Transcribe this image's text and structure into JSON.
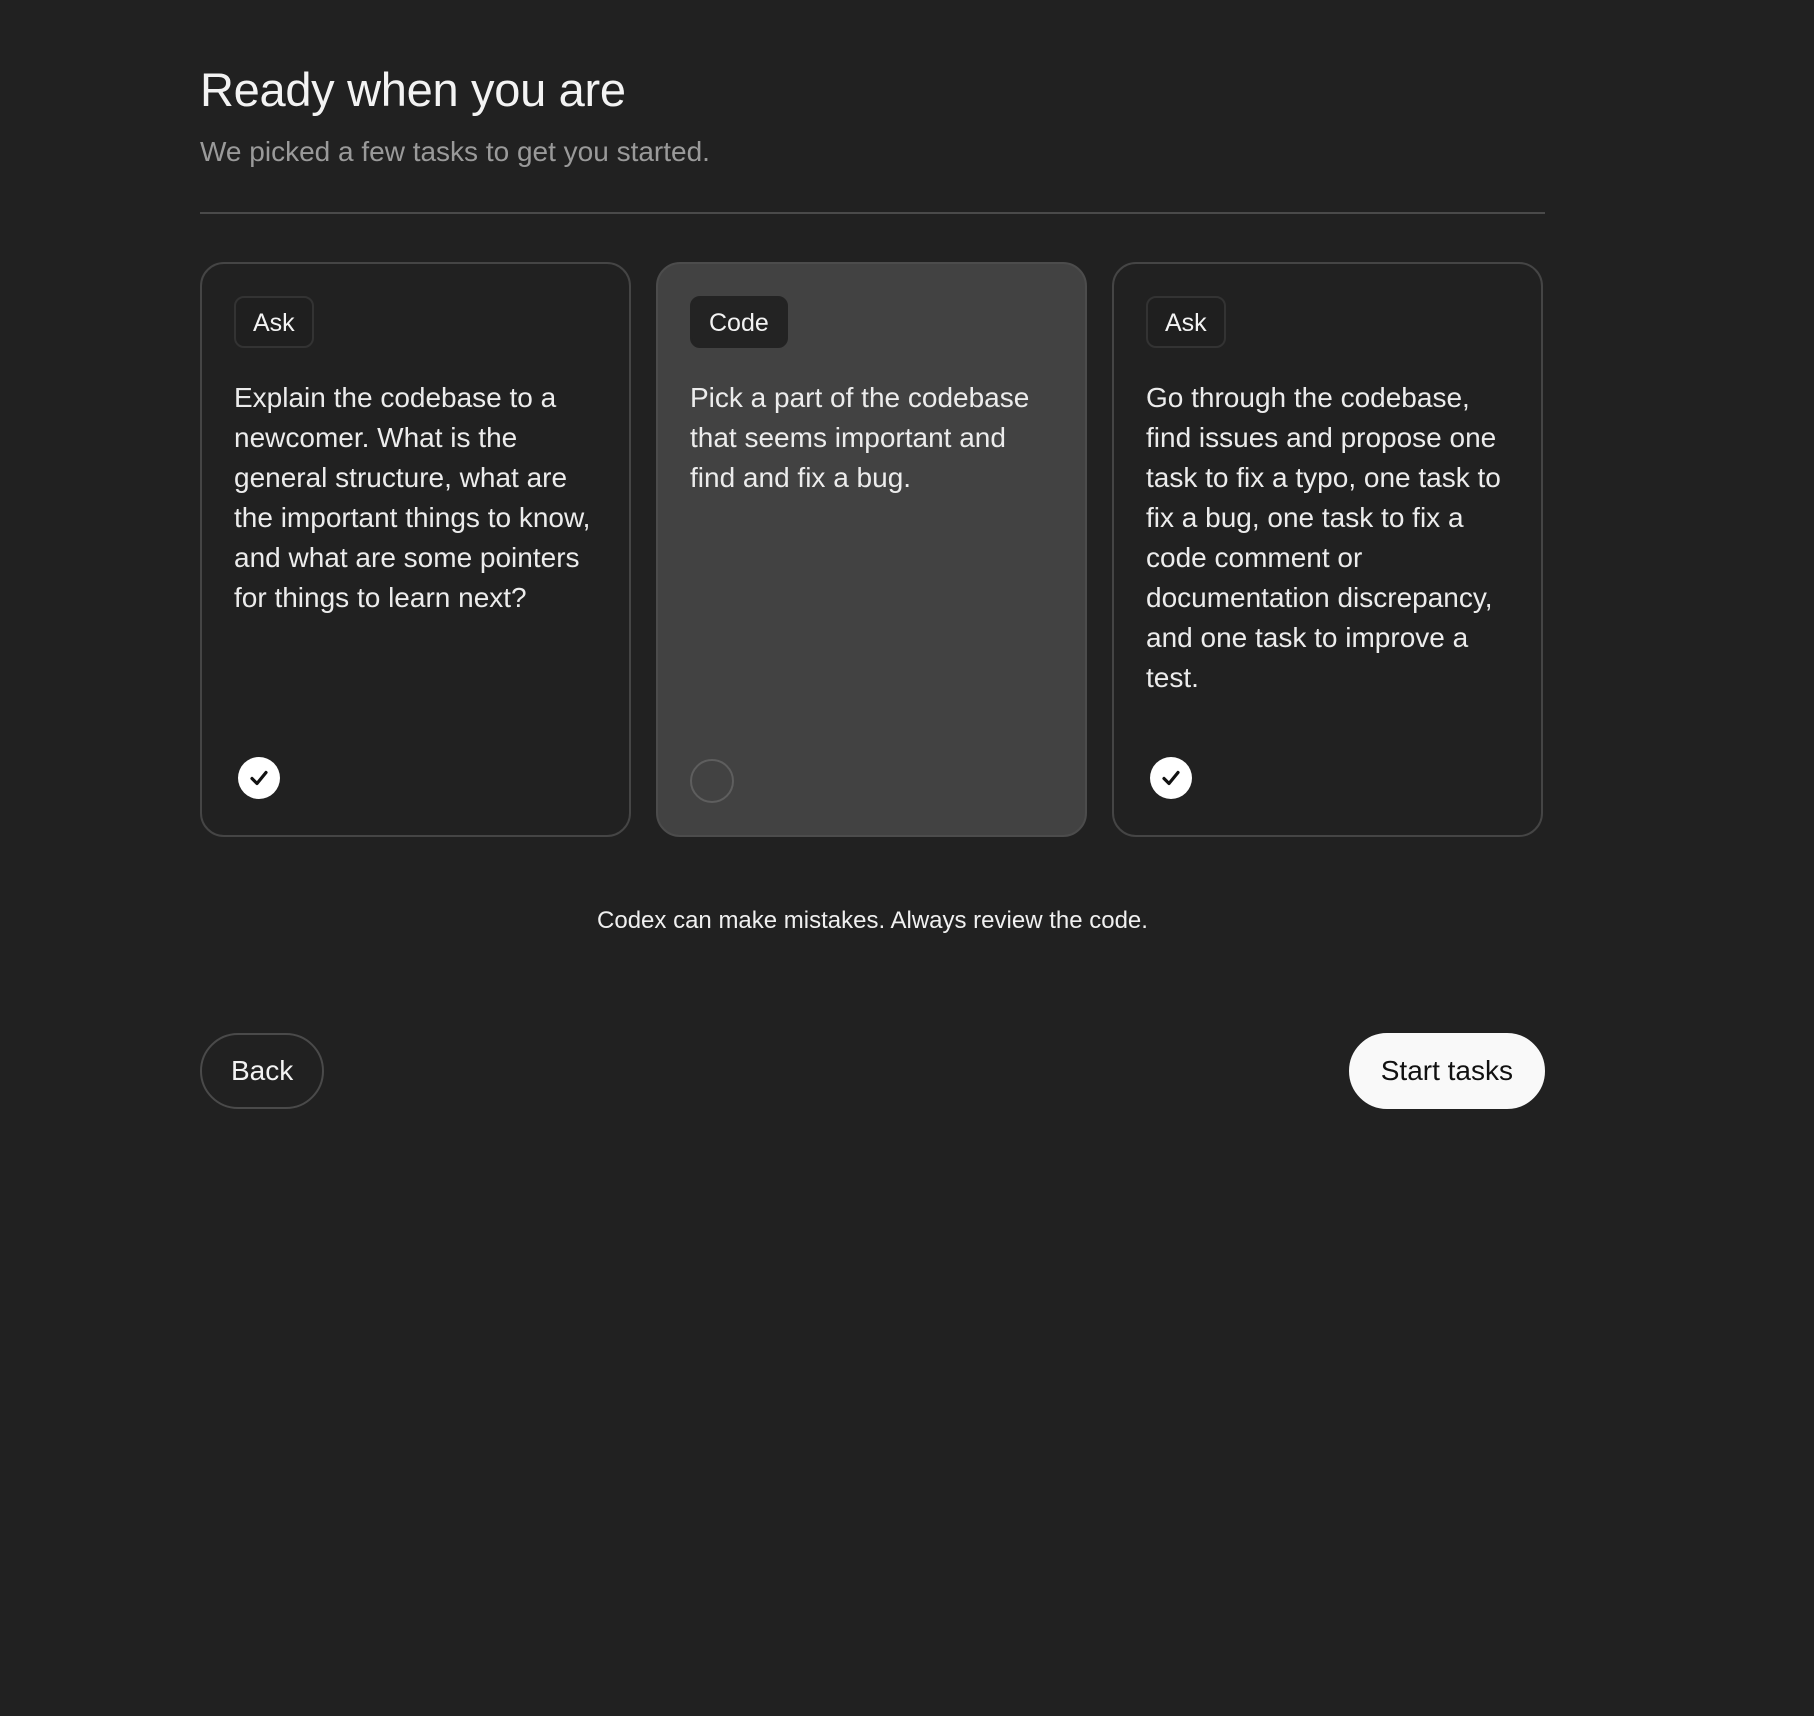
{
  "header": {
    "title": "Ready when you are",
    "subtitle": "We picked a few tasks to get you started."
  },
  "cards": [
    {
      "tag": "Ask",
      "description": "Explain the codebase to a newcomer. What is the general structure, what are the important things to know, and what are some pointers for things to learn next?",
      "selected": true,
      "indicator_icon": "checkmark-circle-icon"
    },
    {
      "tag": "Code",
      "description": "Pick a part of the codebase that seems important and find and fix a bug.",
      "selected": false,
      "indicator_icon": "empty-circle-icon"
    },
    {
      "tag": "Ask",
      "description": "Go through the codebase, find issues and propose one task to fix a typo, one task to fix a bug, one task to fix a code comment or documentation discrepancy, and one task to improve a test.",
      "selected": true,
      "indicator_icon": "checkmark-circle-icon"
    }
  ],
  "disclaimer": "Codex can make mistakes. Always review the code.",
  "actions": {
    "back_label": "Back",
    "start_label": "Start tasks"
  },
  "colors": {
    "background": "#212121",
    "card_selected_bg": "#212121",
    "card_unselected_bg": "#424242",
    "primary_button_bg": "#f9f9f9",
    "text_muted": "#9a9a9a"
  }
}
